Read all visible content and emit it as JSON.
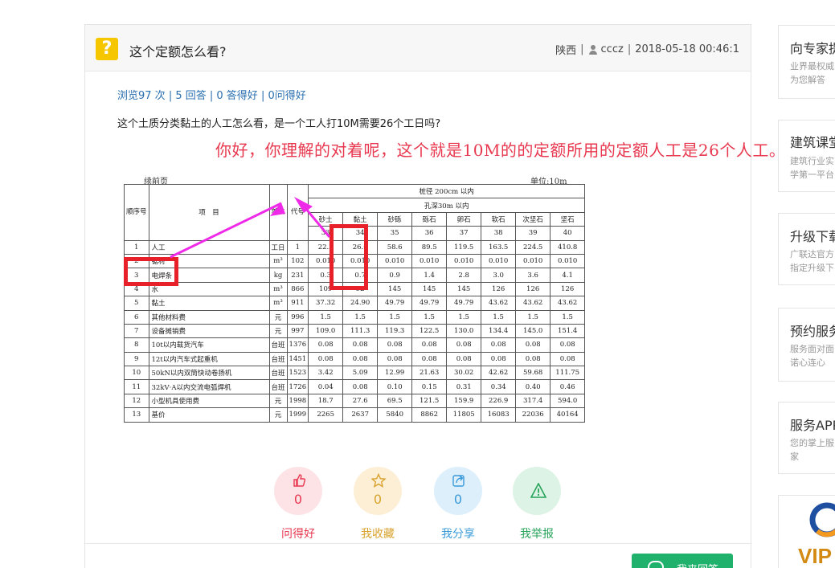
{
  "question": {
    "icon_glyph": "?",
    "title": "这个定额怎么看?",
    "region": "陕西",
    "username": "cccz",
    "datetime": "2018-05-18 00:46:1",
    "stats": {
      "views": "浏览97 次",
      "answers": "5 回答",
      "good_answers": "0 答得好",
      "good_questions": "0问得好"
    },
    "body": "这个土质分类黏土的人工怎么看，是一个工人打10M需要26个工日吗?"
  },
  "attachment": {
    "answer_text": "你好，你理解的对着呢，这个就是10M的的定额所用的定额人工是26个人工。",
    "continued": "续前页",
    "unit": "单位:10m",
    "header_group": "桩径 200cm 以内",
    "header_sub": "孔深30m 以内",
    "col_seq": "顺序号",
    "col_item": "项　目",
    "col_unit": "单位",
    "col_code": "代号",
    "soil_types": [
      "砂土",
      "黏土",
      "砂砾",
      "砾石",
      "卵石",
      "软石",
      "次坚石",
      "坚石"
    ],
    "soil_codes": [
      "33",
      "34",
      "35",
      "36",
      "37",
      "38",
      "39",
      "40"
    ],
    "rows": [
      {
        "no": "1",
        "name": "人工",
        "unit": "工日",
        "code": "1",
        "values": [
          "22.2",
          "26.0",
          "58.6",
          "89.5",
          "119.5",
          "163.5",
          "224.5",
          "410.8"
        ]
      },
      {
        "no": "2",
        "name": "锯材",
        "unit": "m³",
        "code": "102",
        "values": [
          "0.010",
          "0.010",
          "0.010",
          "0.010",
          "0.010",
          "0.010",
          "0.010",
          "0.010"
        ]
      },
      {
        "no": "3",
        "name": "电焊条",
        "unit": "kg",
        "code": "231",
        "values": [
          "0.3",
          "0.7",
          "0.9",
          "1.4",
          "2.8",
          "3.0",
          "3.6",
          "4.1"
        ]
      },
      {
        "no": "4",
        "name": "水",
        "unit": "m³",
        "code": "866",
        "values": [
          "109",
          "92",
          "145",
          "145",
          "145",
          "126",
          "126",
          "126"
        ]
      },
      {
        "no": "5",
        "name": "黏土",
        "unit": "m³",
        "code": "911",
        "values": [
          "37.32",
          "24.90",
          "49.79",
          "49.79",
          "49.79",
          "43.62",
          "43.62",
          "43.62"
        ]
      },
      {
        "no": "6",
        "name": "其他材料费",
        "unit": "元",
        "code": "996",
        "values": [
          "1.5",
          "1.5",
          "1.5",
          "1.5",
          "1.5",
          "1.5",
          "1.5",
          "1.5"
        ]
      },
      {
        "no": "7",
        "name": "设备摊销费",
        "unit": "元",
        "code": "997",
        "values": [
          "109.0",
          "111.3",
          "119.3",
          "122.5",
          "130.0",
          "134.4",
          "145.0",
          "151.4"
        ]
      },
      {
        "no": "8",
        "name": "10t以内载货汽车",
        "unit": "台班",
        "code": "1376",
        "values": [
          "0.08",
          "0.08",
          "0.08",
          "0.08",
          "0.08",
          "0.08",
          "0.08",
          "0.08"
        ]
      },
      {
        "no": "9",
        "name": "12t以内汽车式起重机",
        "unit": "台班",
        "code": "1451",
        "values": [
          "0.08",
          "0.08",
          "0.08",
          "0.08",
          "0.08",
          "0.08",
          "0.08",
          "0.08"
        ]
      },
      {
        "no": "10",
        "name": "50kN以内双筒快动卷扬机",
        "unit": "台班",
        "code": "1523",
        "values": [
          "3.42",
          "5.09",
          "12.99",
          "21.63",
          "30.02",
          "42.62",
          "59.68",
          "111.75"
        ]
      },
      {
        "no": "11",
        "name": "32kV·A以内交流电弧焊机",
        "unit": "台班",
        "code": "1726",
        "values": [
          "0.04",
          "0.08",
          "0.10",
          "0.15",
          "0.31",
          "0.34",
          "0.40",
          "0.46"
        ]
      },
      {
        "no": "12",
        "name": "小型机具使用费",
        "unit": "元",
        "code": "1998",
        "values": [
          "18.7",
          "27.6",
          "69.5",
          "121.5",
          "159.9",
          "226.9",
          "317.4",
          "594.0"
        ]
      },
      {
        "no": "13",
        "name": "基价",
        "unit": "元",
        "code": "1999",
        "values": [
          "2265",
          "2637",
          "5840",
          "8862",
          "11805",
          "16083",
          "22036",
          "40164"
        ]
      }
    ]
  },
  "actions": [
    {
      "label": "问得好",
      "count": "0",
      "color": "#e8384f",
      "bg": "#fde3e6",
      "icon": "thumbs-up-icon"
    },
    {
      "label": "我收藏",
      "count": "0",
      "color": "#d9a22c",
      "bg": "#fcefd6",
      "icon": "star-icon"
    },
    {
      "label": "我分享",
      "count": "0",
      "color": "#3a9ad9",
      "bg": "#dceffb",
      "icon": "share-icon"
    },
    {
      "label": "我举报",
      "count": "",
      "color": "#27a35a",
      "bg": "#dcf3e5",
      "icon": "warning-icon"
    }
  ],
  "answer_button": "我来回答",
  "sidebar": [
    {
      "title": "向专家提",
      "desc": [
        "业界最权威",
        "为您解答"
      ]
    },
    {
      "title": "建筑课堂",
      "desc": [
        "建筑行业实",
        "学第一平台"
      ]
    },
    {
      "title": "升级下载",
      "desc": [
        "广联达官方",
        "指定升级下"
      ]
    },
    {
      "title": "预约服务",
      "desc": [
        "服务面对面",
        "诺心连心"
      ]
    },
    {
      "title": "服务APP",
      "desc": [
        "您的掌上服",
        "家"
      ]
    },
    {
      "title": "",
      "logo_text": "VIP",
      "desc": []
    }
  ],
  "colors": {
    "accent_green": "#20b26c",
    "question_yellow": "#f6c700",
    "annotation_red": "#e8384f",
    "arrow_magenta": "#ee2ae8"
  }
}
